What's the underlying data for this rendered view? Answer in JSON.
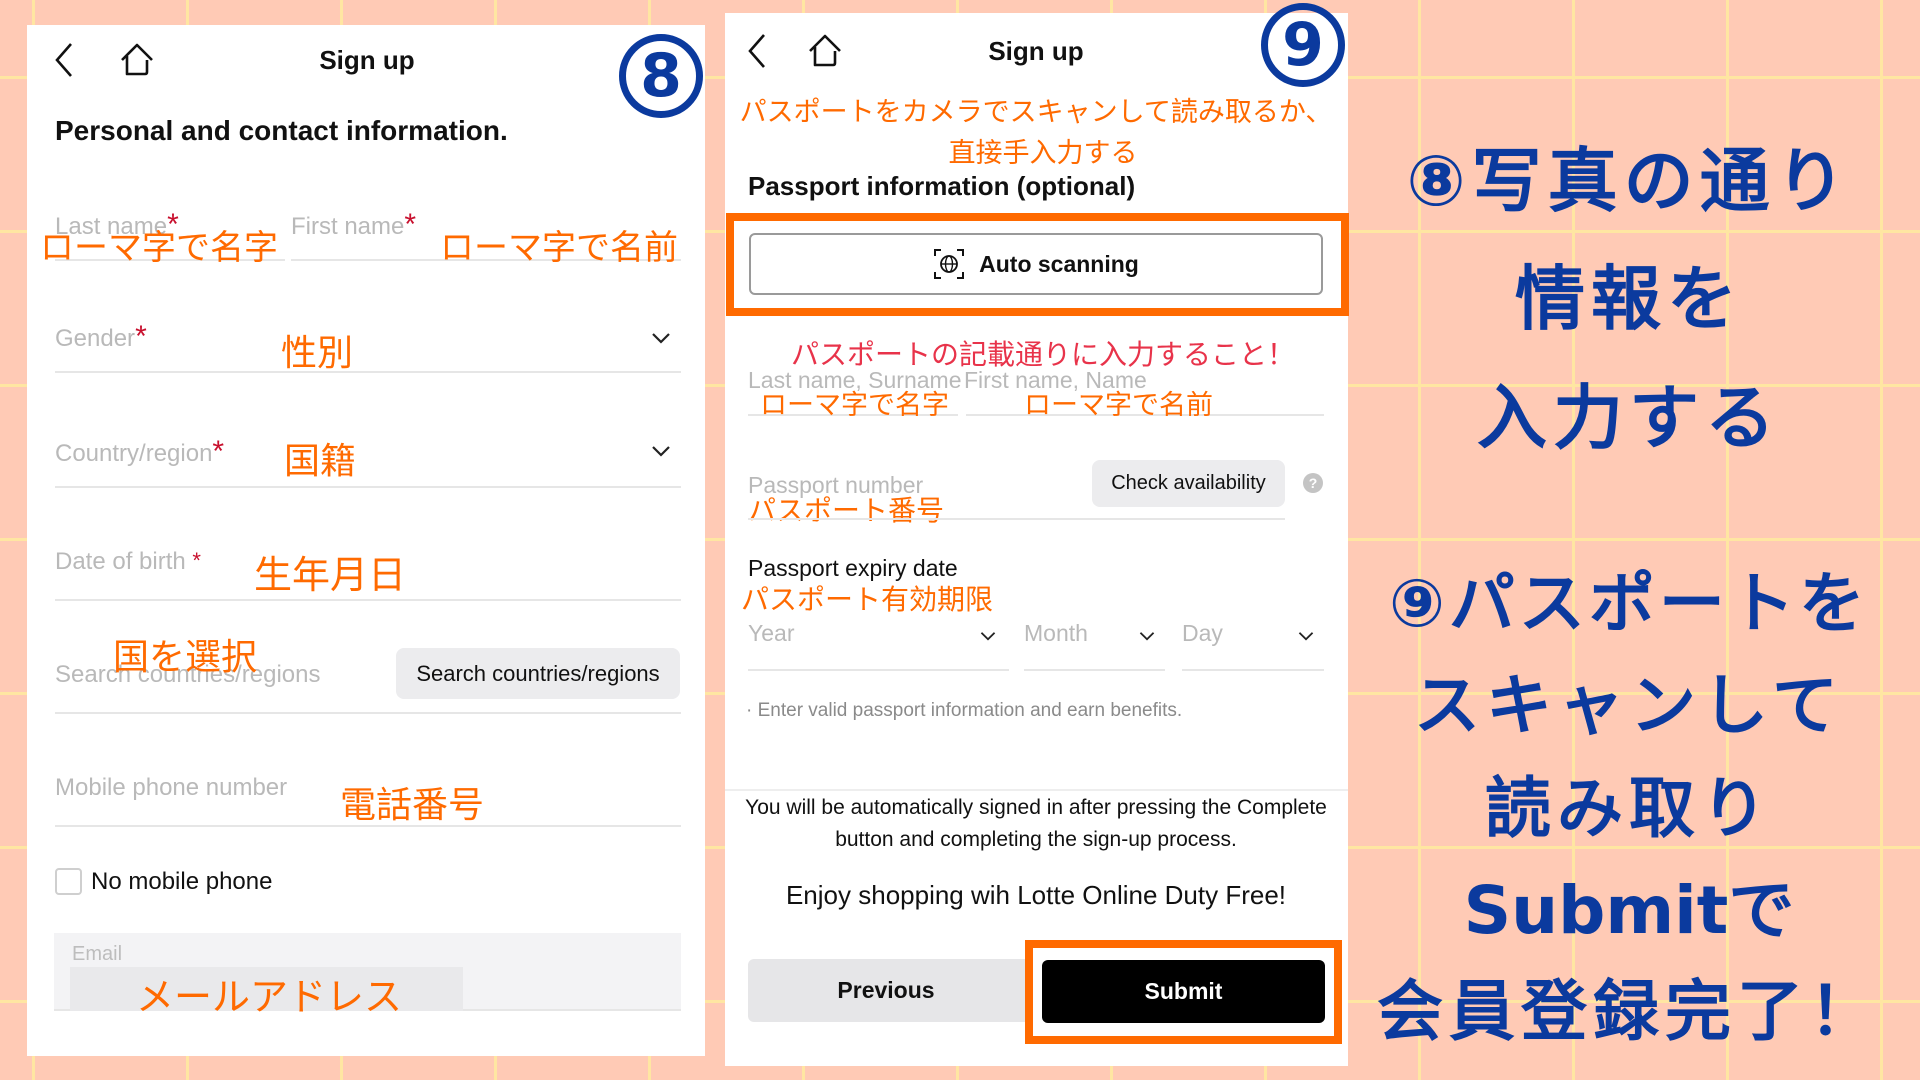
{
  "colors": {
    "background": "#FFCAB5",
    "grid": "#FFE6A2",
    "annotation_orange": "#FF6A00",
    "annotation_red": "#E8334A",
    "heading_blue": "#0B3A9E",
    "required_red": "#C8102E"
  },
  "panel1": {
    "step_number": "8",
    "header": {
      "back_icon": "chevron-left-icon",
      "home_icon": "home-icon",
      "title": "Sign up"
    },
    "section_title": "Personal and contact information.",
    "fields": {
      "last_name": {
        "placeholder": "Last name",
        "required_mark": "*",
        "annotation": "ローマ字で名字"
      },
      "first_name": {
        "placeholder": "First name",
        "required_mark": "*",
        "annotation": "ローマ字で名前"
      },
      "gender": {
        "placeholder": "Gender",
        "required_mark": "*",
        "annotation": "性別",
        "icon": "chevron-down-icon"
      },
      "country": {
        "placeholder": "Country/region",
        "required_mark": "*",
        "annotation": "国籍",
        "icon": "chevron-down-icon"
      },
      "dob": {
        "placeholder": "Date of birth",
        "required_mark": "*",
        "annotation": "生年月日"
      },
      "search_country": {
        "placeholder": "Search countries/regions",
        "button_label": "Search countries/regions",
        "annotation": "国を選択"
      },
      "mobile": {
        "placeholder": "Mobile phone number",
        "annotation": "電話番号"
      },
      "no_mobile": {
        "label": "No mobile phone",
        "checked": false
      },
      "email": {
        "placeholder": "Email",
        "annotation": "メールアドレス"
      }
    }
  },
  "panel2": {
    "step_number": "9",
    "header": {
      "back_icon": "chevron-left-icon",
      "home_icon": "home-icon",
      "title": "Sign up"
    },
    "top_annotation_line1": "パスポートをカメラでスキャンして読み取るか、",
    "top_annotation_line2": "直接手入力する",
    "section_title": "Passport information (optional)",
    "auto_scan_label": "Auto scanning",
    "auto_scan_icon": "scan-globe-icon",
    "warning_annotation": "パスポートの記載通りに入力すること！",
    "fields": {
      "last_name": {
        "placeholder": "Last name, Surname",
        "annotation": "ローマ字で名字"
      },
      "first_name": {
        "placeholder": "First name, Name",
        "annotation": "ローマ字で名前"
      },
      "passport_number": {
        "placeholder": "Passport number",
        "annotation": "パスポート番号",
        "button_label": "Check availability",
        "help_icon": "question-circle-icon"
      },
      "expiry": {
        "label": "Passport expiry date",
        "annotation": "パスポート有効期限",
        "year": "Year",
        "month": "Month",
        "day": "Day"
      }
    },
    "bullet_note": "· Enter valid passport information and earn benefits.",
    "signin_note_line1": "You will be automatically signed in after pressing the Complete",
    "signin_note_line2": "button and completing the sign-up process.",
    "enjoy_text": "Enjoy shopping wih Lotte Online Duty Free!",
    "previous_label": "Previous",
    "submit_label": "Submit"
  },
  "instructions": {
    "step8": [
      "⑧写真の通り",
      "情報を",
      "入力する"
    ],
    "step9": [
      "⑨パスポートを",
      "スキャンして",
      "読み取り",
      "Submitで",
      "会員登録完了！"
    ]
  }
}
